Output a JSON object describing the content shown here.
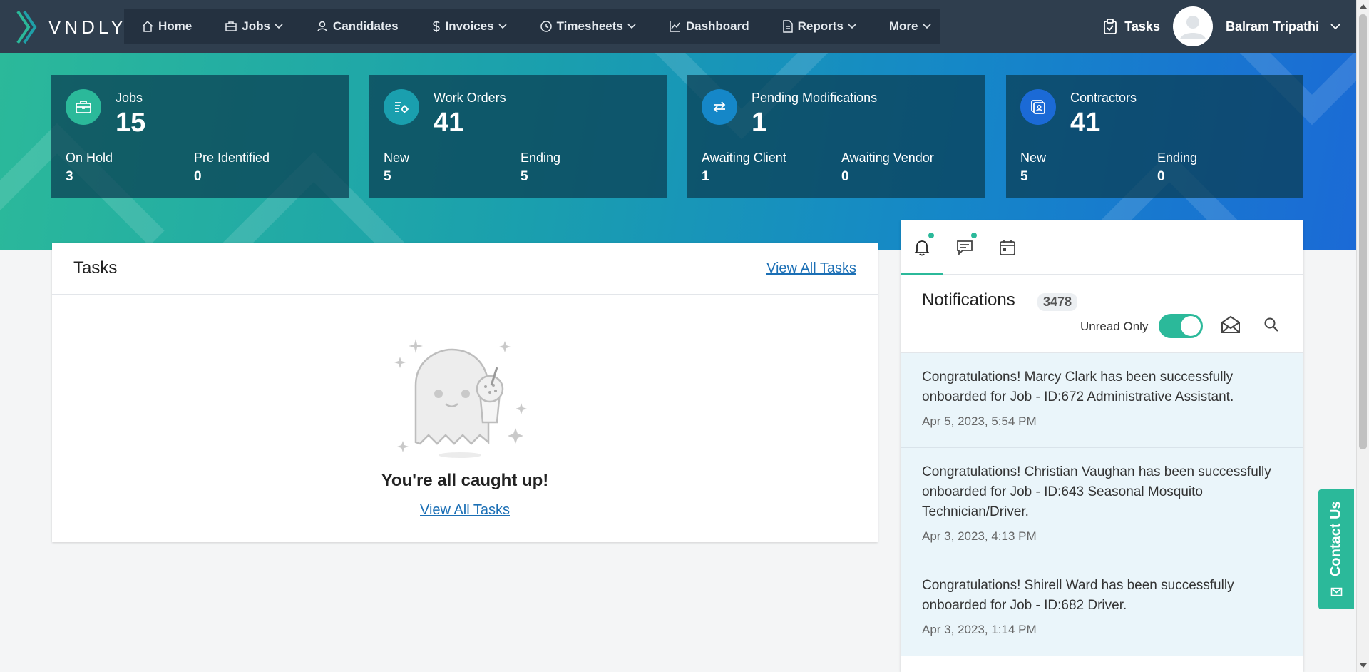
{
  "brand": {
    "name": "VNDLY"
  },
  "nav": {
    "items": [
      {
        "label": "Home",
        "icon": "home-icon",
        "has_dropdown": false
      },
      {
        "label": "Jobs",
        "icon": "briefcase-icon",
        "has_dropdown": true
      },
      {
        "label": "Candidates",
        "icon": "person-icon",
        "has_dropdown": false
      },
      {
        "label": "Invoices",
        "icon": "dollar-icon",
        "has_dropdown": true
      },
      {
        "label": "Timesheets",
        "icon": "clock-icon",
        "has_dropdown": true
      },
      {
        "label": "Dashboard",
        "icon": "chart-icon",
        "has_dropdown": false
      },
      {
        "label": "Reports",
        "icon": "document-icon",
        "has_dropdown": true
      },
      {
        "label": "More",
        "icon": "",
        "has_dropdown": true
      }
    ]
  },
  "header": {
    "tasks_label": "Tasks",
    "user_name": "Balram Tripathi"
  },
  "stats": [
    {
      "title": "Jobs",
      "value": "15",
      "icon": "briefcase-icon",
      "icon_color": "#2bb99a",
      "sub": [
        {
          "label": "On Hold",
          "value": "3"
        },
        {
          "label": "Pre Identified",
          "value": "0"
        }
      ]
    },
    {
      "title": "Work Orders",
      "value": "41",
      "icon": "work-order-icon",
      "icon_color": "#1a9fae",
      "sub": [
        {
          "label": "New",
          "value": "5"
        },
        {
          "label": "Ending",
          "value": "5"
        }
      ]
    },
    {
      "title": "Pending Modifications",
      "value": "1",
      "icon": "swap-arrows-icon",
      "icon_color": "#1587c8",
      "sub": [
        {
          "label": "Awaiting Client",
          "value": "1"
        },
        {
          "label": "Awaiting Vendor",
          "value": "0"
        }
      ]
    },
    {
      "title": "Contractors",
      "value": "41",
      "icon": "contractor-badge-icon",
      "icon_color": "#1b6ad6",
      "sub": [
        {
          "label": "New",
          "value": "5"
        },
        {
          "label": "Ending",
          "value": "0"
        }
      ]
    }
  ],
  "tasks_panel": {
    "title": "Tasks",
    "view_all": "View All Tasks",
    "empty_message": "You're all caught up!",
    "empty_link": "View All Tasks"
  },
  "notifications": {
    "title": "Notifications",
    "count": "3478",
    "unread_only_label": "Unread Only",
    "unread_only_on": true,
    "items": [
      {
        "text": "Congratulations! Marcy Clark has been successfully onboarded for Job - ID:672 Administrative Assistant.",
        "time": "Apr 5, 2023, 5:54 PM"
      },
      {
        "text": "Congratulations! Christian Vaughan has been successfully onboarded for Job - ID:643 Seasonal Mosquito Technician/Driver.",
        "time": "Apr 3, 2023, 4:13 PM"
      },
      {
        "text": "Congratulations! Shirell Ward has been successfully onboarded for Job - ID:682 Driver.",
        "time": "Apr 3, 2023, 1:14 PM"
      }
    ]
  },
  "contact": {
    "label": "Contact Us"
  },
  "colors": {
    "accent": "#2bb99a",
    "nav_bg": "#2f3e4e",
    "link": "#1b6fb5"
  }
}
